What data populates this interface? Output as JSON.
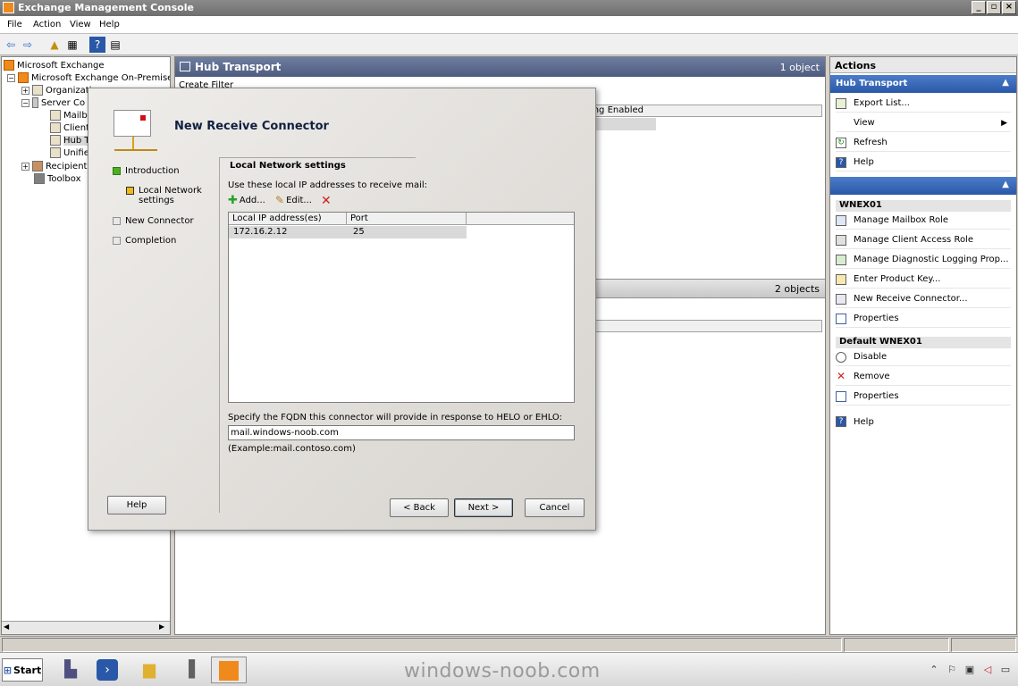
{
  "window": {
    "title": "Exchange Management Console"
  },
  "menu": {
    "items": [
      "File",
      "Action",
      "View",
      "Help"
    ]
  },
  "tree": {
    "items": [
      {
        "label": "Microsoft Exchange"
      },
      {
        "label": "Microsoft Exchange On-Premises (v"
      },
      {
        "label": "Organizati"
      },
      {
        "label": "Server Co"
      },
      {
        "label": "Mailbo"
      },
      {
        "label": "Client"
      },
      {
        "label": "Hub T"
      },
      {
        "label": "Unifie"
      },
      {
        "label": "Recipient"
      },
      {
        "label": "Toolbox"
      }
    ]
  },
  "main": {
    "title": "Hub Transport",
    "count": "1 object",
    "filter_label": "Create Filter",
    "column_partial": "ting Enabled",
    "lower_count": "2 objects"
  },
  "actions": {
    "title": "Actions",
    "section1": "Hub Transport",
    "items1": [
      "Export List...",
      "View",
      "Refresh",
      "Help"
    ],
    "server_group": "WNEX01",
    "items2": [
      "Manage Mailbox Role",
      "Manage Client Access Role",
      "Manage Diagnostic Logging Prop...",
      "Enter Product Key...",
      "New Receive Connector...",
      "Properties"
    ],
    "connector_group": "Default WNEX01",
    "items3": [
      "Disable",
      "Remove",
      "Properties"
    ],
    "help": "Help"
  },
  "wizard": {
    "title": "New Receive Connector",
    "steps": [
      "Introduction",
      "Local Network settings",
      "New Connector",
      "Completion"
    ],
    "section_title": "Local Network settings",
    "description": "Use these local IP addresses to receive mail:",
    "add_label": "Add...",
    "edit_label": "Edit...",
    "columns": [
      "Local IP address(es)",
      "Port"
    ],
    "rows": [
      {
        "ip": "172.16.2.12",
        "port": "25"
      }
    ],
    "fqdn_label": "Specify the FQDN this connector will provide in response to HELO or EHLO:",
    "fqdn_value": "mail.windows-noob.com",
    "fqdn_example": "(Example:mail.contoso.com)",
    "buttons": {
      "help": "Help",
      "back": "< Back",
      "next": "Next >",
      "cancel": "Cancel"
    }
  },
  "taskbar": {
    "start_label": "Start",
    "watermark": "windows-noob.com"
  }
}
